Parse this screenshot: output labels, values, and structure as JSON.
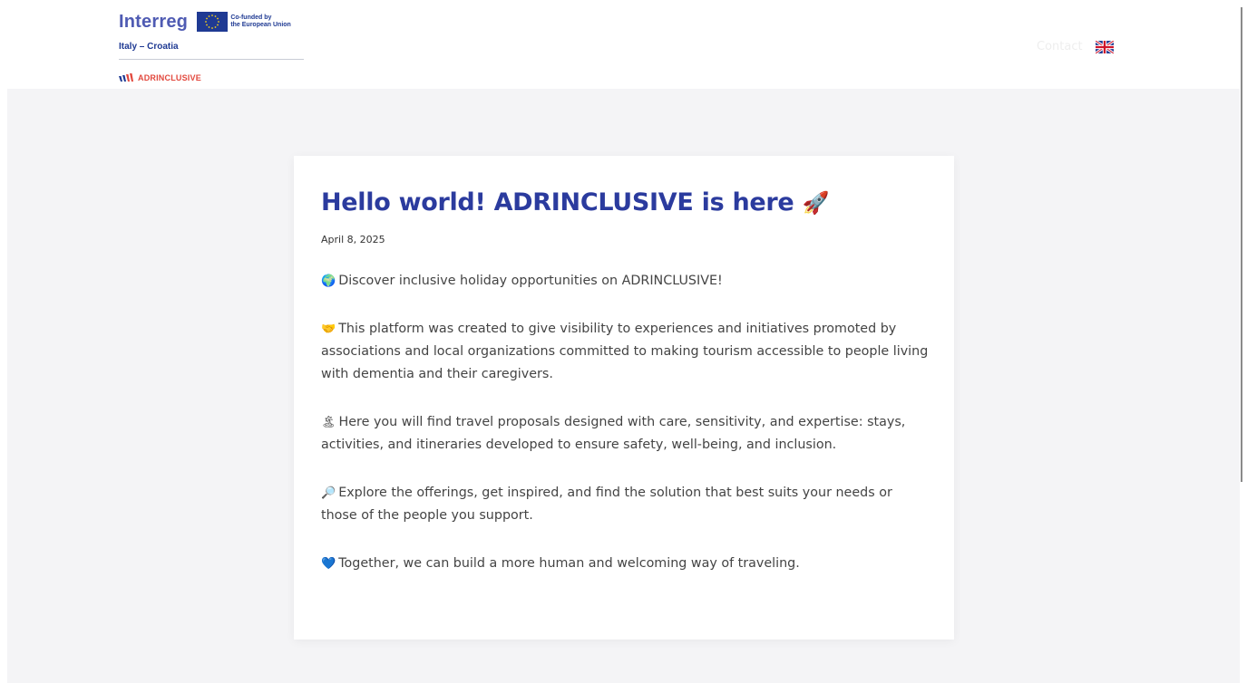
{
  "header": {
    "brand": "Interreg",
    "cofunded_line1": "Co-funded by",
    "cofunded_line2": "the European Union",
    "region": "Italy – Croatia",
    "project": "ADRINCLUSIVE",
    "nav_contact": "Contact",
    "language_flag": "uk-flag-icon"
  },
  "post": {
    "title": "Hello world! ADRINCLUSIVE is here",
    "title_emoji": "🚀",
    "date": "April 8, 2025",
    "paragraphs": [
      {
        "emoji": "🌍",
        "text": "Discover inclusive holiday opportunities on ADRINCLUSIVE!"
      },
      {
        "emoji": "🤝",
        "text": "This platform was created to give visibility to experiences and initiatives promoted by associations and local organizations committed to making tourism accessible to people living with dementia and their caregivers."
      },
      {
        "emoji": "🏝",
        "text": "Here you will find travel proposals designed with care, sensitivity, and expertise: stays, activities, and itineraries developed to ensure safety, well-being, and inclusion."
      },
      {
        "emoji": "🔎",
        "text": "Explore the offerings, get inspired, and find the solution that best suits your needs or those of the people you support."
      },
      {
        "emoji": "💙",
        "text": "Together, we can build a more human and welcoming way of traveling."
      }
    ]
  },
  "colors": {
    "title": "#2b3b9e",
    "brand_blue": "#1f3a93",
    "project_red": "#e2483d",
    "background": "#f4f4f6"
  }
}
